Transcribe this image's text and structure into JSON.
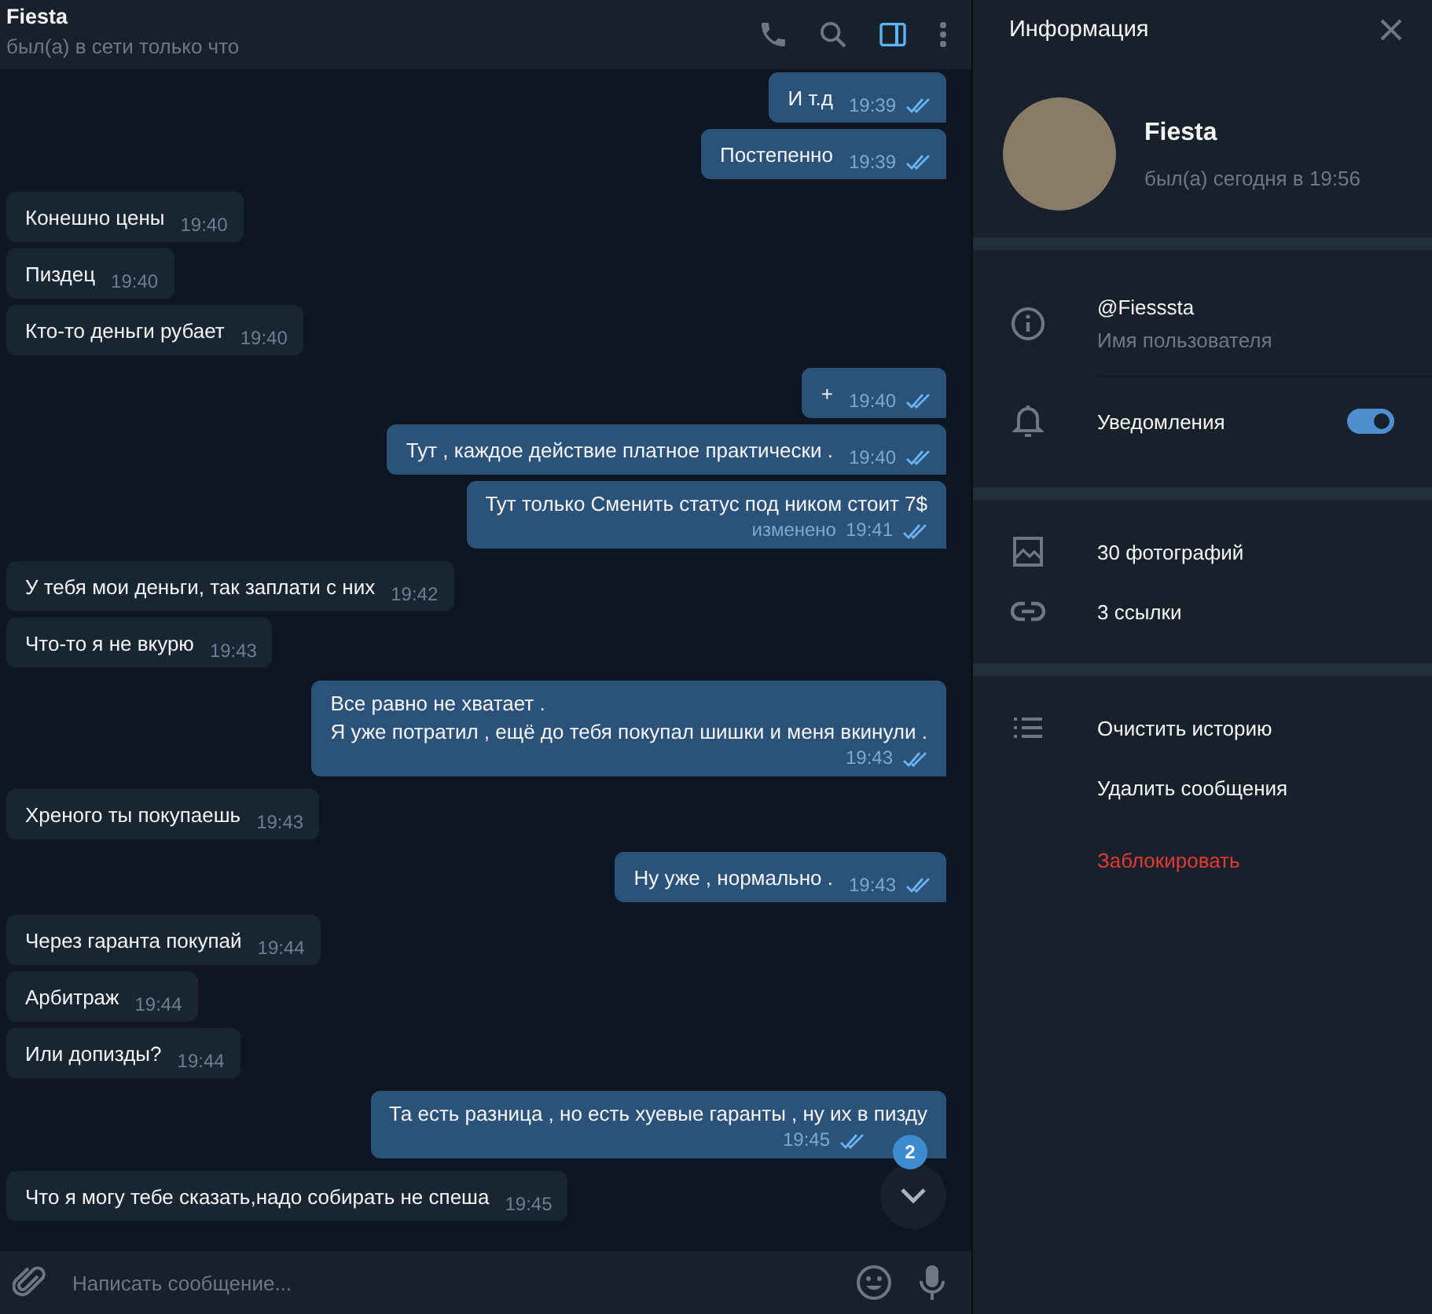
{
  "chat": {
    "title": "Fiesta",
    "status": "был(а) в сети только что",
    "panel_toggle": {
      "selected": true
    }
  },
  "messages": [
    {
      "kind": "out",
      "text": "И т.д",
      "time": "19:39",
      "read": true
    },
    {
      "kind": "out",
      "text": "Постепенно",
      "time": "19:39",
      "read": true
    },
    {
      "kind": "in",
      "text": "Конешно цены",
      "time": "19:40"
    },
    {
      "kind": "in",
      "text": "Пиздец",
      "time": "19:40"
    },
    {
      "kind": "in",
      "text": "Кто-то деньги рубает",
      "time": "19:40"
    },
    {
      "kind": "out",
      "text": "+",
      "time": "19:40",
      "read": true
    },
    {
      "kind": "out",
      "text": "Тут , каждое действие платное практически .",
      "time": "19:40",
      "read": true
    },
    {
      "kind": "out",
      "text": "Тут только Сменить статус под ником  стоит 7$",
      "time": "19:41",
      "edited": "изменено",
      "read": true
    },
    {
      "kind": "in",
      "text": "У тебя мои деньги, так заплати  с них",
      "time": "19:42"
    },
    {
      "kind": "in",
      "text": "Что-то я не вкурю",
      "time": "19:43"
    },
    {
      "kind": "out",
      "text": "Все равно не хватает .\nЯ уже потратил , ещё до тебя покупал шишки и меня вкинули .",
      "time": "19:43",
      "read": true
    },
    {
      "kind": "in",
      "text": "Хреного ты покупаешь",
      "time": "19:43"
    },
    {
      "kind": "out",
      "text": "Ну уже , нормально .",
      "time": "19:43",
      "read": true
    },
    {
      "kind": "in",
      "text": "Через гаранта покупай",
      "time": "19:44"
    },
    {
      "kind": "in",
      "text": "Арбитраж",
      "time": "19:44"
    },
    {
      "kind": "in",
      "text": "Или допизды?",
      "time": "19:44"
    },
    {
      "kind": "out",
      "text": "Та есть разница , но есть хуевые гаранты , ну их в пизду",
      "time": "19:45",
      "read": true,
      "time_below": true
    },
    {
      "kind": "in",
      "text": "Что я могу тебе сказать,надо собирать не спеша",
      "time": "19:45"
    }
  ],
  "scroll_down": {
    "unread_badge": "2"
  },
  "composer": {
    "placeholder": "Написать сообщение..."
  },
  "info_panel": {
    "title": "Информация",
    "name": "Fiesta",
    "status": "был(а) сегодня в 19:56",
    "username": {
      "value": "@Fiesssta",
      "label": "Имя пользователя"
    },
    "notifications": {
      "label": "Уведомления",
      "on": true
    },
    "media": [
      "30 фотографий",
      "3 ссылки"
    ],
    "actions": [
      {
        "label": "Очистить историю",
        "danger": false
      },
      {
        "label": "Удалить сообщения",
        "danger": false
      },
      {
        "label": "Заблокировать",
        "danger": true
      }
    ]
  }
}
